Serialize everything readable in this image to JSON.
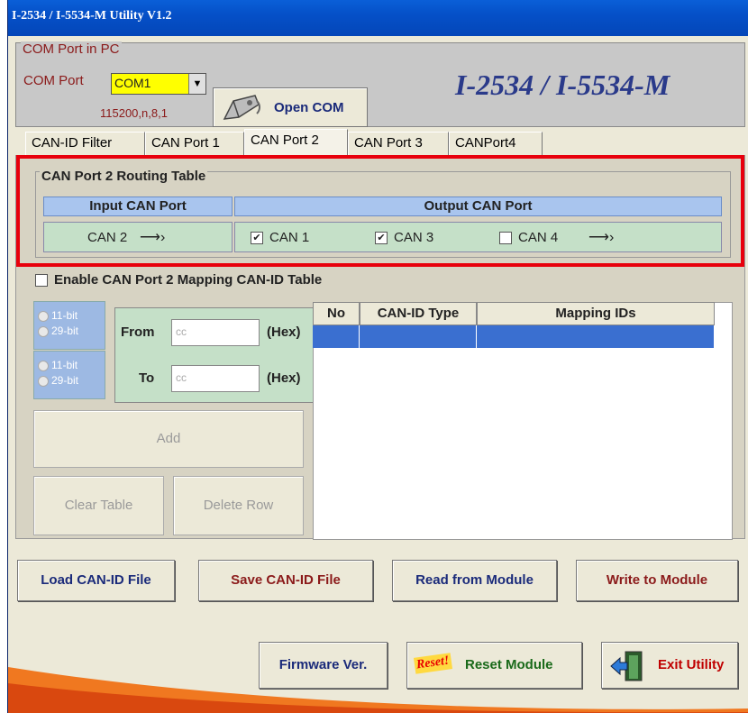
{
  "window": {
    "title": "I-2534 / I-5534-M Utility V1.2"
  },
  "com": {
    "group_label": "COM Port in PC",
    "port_label": "COM Port",
    "port_value": "COM1",
    "baud": "115200,n,8,1",
    "open_label": "Open COM",
    "brand": "I-2534 / I-5534-M"
  },
  "tabs": [
    "CAN-ID Filter",
    "CAN Port 1",
    "CAN Port 2",
    "CAN Port 3",
    "CANPort4"
  ],
  "active_tab": "CAN Port 2",
  "routing": {
    "title": "CAN Port 2 Routing Table",
    "input_header": "Input CAN Port",
    "output_header": "Output CAN Port",
    "input_value": "CAN 2",
    "arrow": "⟶›",
    "outputs": [
      {
        "label": "CAN 1",
        "checked": true
      },
      {
        "label": "CAN 3",
        "checked": true
      },
      {
        "label": "CAN 4",
        "checked": false
      }
    ],
    "out_arrow": "⟶›"
  },
  "mapping": {
    "enable_label": "Enable CAN Port 2 Mapping CAN-ID Table",
    "enabled": false,
    "bit11": "11-bit",
    "bit29": "29-bit",
    "from_label": "From",
    "to_label": "To",
    "hex": "(Hex)",
    "placeholder": "cc",
    "columns": [
      "No",
      "CAN-ID Type",
      "Mapping IDs"
    ],
    "add_label": "Add",
    "clear_label": "Clear Table",
    "delete_label": "Delete Row"
  },
  "file_buttons": {
    "load": "Load CAN-ID File",
    "save": "Save CAN-ID File",
    "read": "Read from Module",
    "write": "Write to Module"
  },
  "bottom_buttons": {
    "firmware": "Firmware Ver.",
    "reset_badge": "Reset!",
    "reset": "Reset Module",
    "exit": "Exit Utility"
  },
  "colors": {
    "highlight": "#e8000c",
    "combo": "#ffff00",
    "header_blue": "#a9c5ee",
    "row_green": "#c5e0c8",
    "selection": "#3a6fd0"
  }
}
